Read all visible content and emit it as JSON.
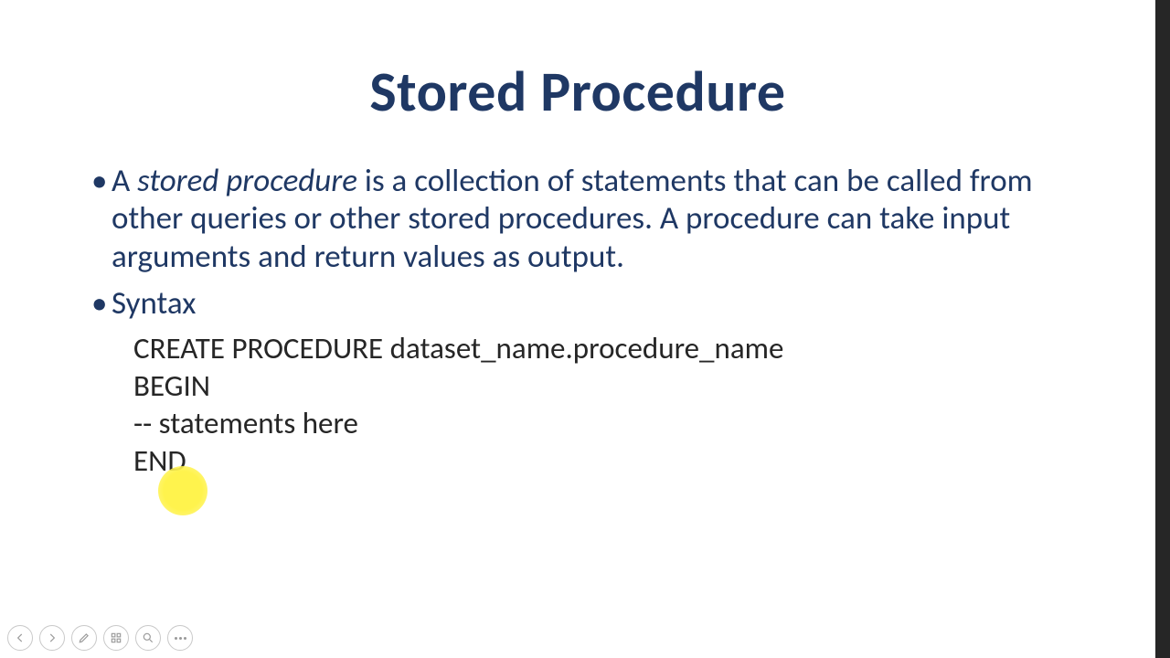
{
  "slide": {
    "title": "Stored Procedure",
    "bullet1": {
      "prefix": "A ",
      "emphasis": "stored procedure",
      "rest": " is a collection of statements that can be called from other queries or other stored procedures. A procedure can take input arguments and return values as output."
    },
    "bullet2": {
      "label": "Syntax",
      "lines": {
        "l1": "CREATE PROCEDURE dataset_name.procedure_name",
        "l2": "BEGIN",
        "l3": "-- statements here",
        "l4": "END"
      }
    }
  },
  "toolbar": {
    "prev": "Previous",
    "next": "Next",
    "pen": "Pen",
    "slides": "See all slides",
    "zoom": "Zoom",
    "more": "More"
  }
}
